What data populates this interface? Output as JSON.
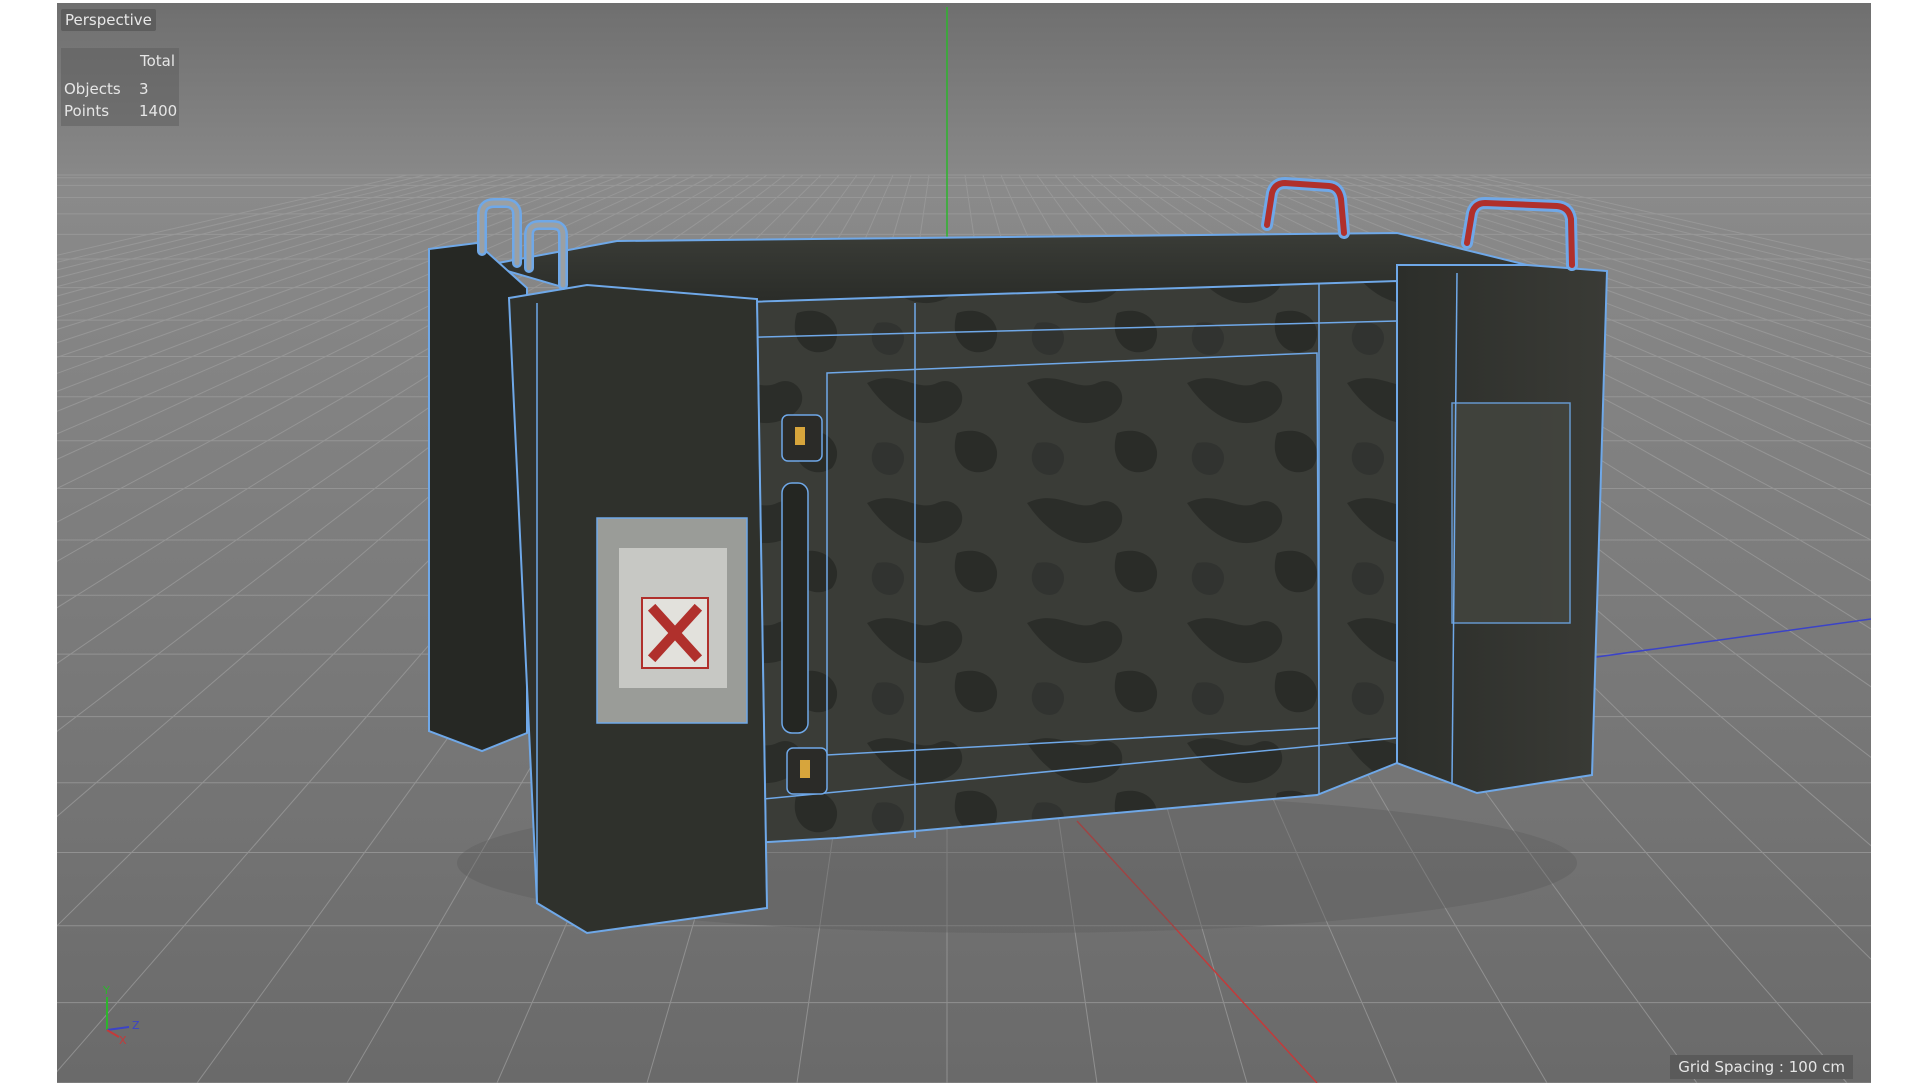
{
  "viewport": {
    "view_name": "Perspective",
    "stats": {
      "header": "Total",
      "rows": [
        {
          "label": "Objects",
          "value": "3"
        },
        {
          "label": "Points",
          "value": "1400"
        }
      ]
    },
    "grid_spacing": "Grid Spacing : 100 cm",
    "axis_labels": {
      "y": "Y",
      "z": "Z",
      "x": "X"
    }
  },
  "colors": {
    "background": "#7a7a7a",
    "grid_line": "#9a9a9a",
    "axis_green": "#2db52d",
    "axis_red": "#c43a3a",
    "axis_blue": "#3b43c8",
    "wireframe": "#6fa8e8",
    "crate_body": "#2e302c",
    "handle_red": "#b0302c"
  },
  "model": {
    "name": "military-crate",
    "label_icon": "red-x-icon"
  }
}
